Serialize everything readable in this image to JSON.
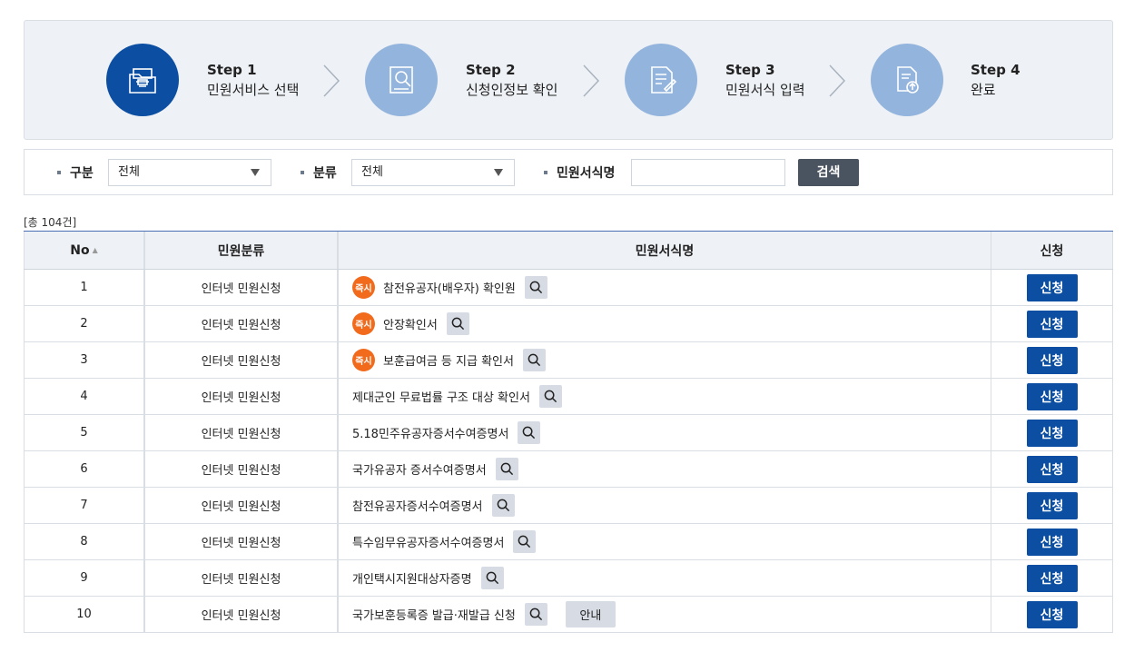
{
  "steps": [
    {
      "num": "Step 1",
      "label": "민원서비스 선택",
      "active": true
    },
    {
      "num": "Step 2",
      "label": "신청인정보 확인",
      "active": false
    },
    {
      "num": "Step 3",
      "label": "민원서식 입력",
      "active": false
    },
    {
      "num": "Step 4",
      "label": "완료",
      "active": false
    }
  ],
  "search": {
    "category_label": "구분",
    "category_value": "전체",
    "class_label": "분류",
    "class_value": "전체",
    "form_label": "민원서식명",
    "form_value": "",
    "button": "검색"
  },
  "total": "[총 104건]",
  "table": {
    "headers": [
      "No",
      "민원분류",
      "민원서식명",
      "신청"
    ],
    "badge_label": "즉시",
    "guide_label": "안내",
    "rows": [
      {
        "no": "1",
        "type": "인터넷 민원신청",
        "name": "참전유공자(배우자) 확인원",
        "instant": true,
        "guide": false,
        "action": "신청"
      },
      {
        "no": "2",
        "type": "인터넷 민원신청",
        "name": "안장확인서",
        "instant": true,
        "guide": false,
        "action": "신청"
      },
      {
        "no": "3",
        "type": "인터넷 민원신청",
        "name": "보훈급여금 등 지급 확인서",
        "instant": true,
        "guide": false,
        "action": "신청"
      },
      {
        "no": "4",
        "type": "인터넷 민원신청",
        "name": "제대군인 무료법률 구조 대상 확인서",
        "instant": false,
        "guide": false,
        "action": "신청"
      },
      {
        "no": "5",
        "type": "인터넷 민원신청",
        "name": "5.18민주유공자증서수여증명서",
        "instant": false,
        "guide": false,
        "action": "신청"
      },
      {
        "no": "6",
        "type": "인터넷 민원신청",
        "name": "국가유공자 증서수여증명서",
        "instant": false,
        "guide": false,
        "action": "신청"
      },
      {
        "no": "7",
        "type": "인터넷 민원신청",
        "name": "참전유공자증서수여증명서",
        "instant": false,
        "guide": false,
        "action": "신청"
      },
      {
        "no": "8",
        "type": "인터넷 민원신청",
        "name": "특수임무유공자증서수여증명서",
        "instant": false,
        "guide": false,
        "action": "신청"
      },
      {
        "no": "9",
        "type": "인터넷 민원신청",
        "name": "개인택시지원대상자증명",
        "instant": false,
        "guide": false,
        "action": "신청"
      },
      {
        "no": "10",
        "type": "인터넷 민원신청",
        "name": "국가보훈등록증 발급·재발급 신청",
        "instant": false,
        "guide": true,
        "action": "신청"
      }
    ]
  },
  "colors": {
    "primary": "#0b4ea2",
    "step_inactive": "#93b4dc",
    "badge": "#f26a1b",
    "search_button": "#4a5360"
  }
}
